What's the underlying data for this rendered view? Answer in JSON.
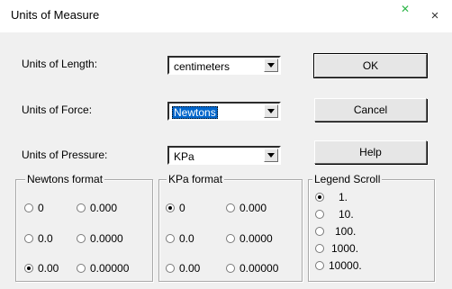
{
  "window": {
    "title": "Units of Measure",
    "close_glyph": "×",
    "background_mark": "✕"
  },
  "fields": [
    {
      "label": "Units of Length:",
      "value": "centimeters",
      "selected": false
    },
    {
      "label": "Units of Force:",
      "value": "Newtons",
      "selected": true
    },
    {
      "label": "Units of Pressure:",
      "value": "KPa",
      "selected": false
    }
  ],
  "buttons": {
    "ok": "OK",
    "cancel": "Cancel",
    "help": "Help"
  },
  "newtons_format": {
    "title": "Newtons format",
    "options": [
      "0",
      "0.000",
      "0.0",
      "0.0000",
      "0.00",
      "0.00000"
    ],
    "selected": "0.00"
  },
  "kpa_format": {
    "title": "KPa format",
    "options": [
      "0",
      "0.000",
      "0.0",
      "0.0000",
      "0.00",
      "0.00000"
    ],
    "selected": "0"
  },
  "legend_scroll": {
    "title": "Legend Scroll",
    "options": [
      "1.",
      "10.",
      "100.",
      "1000.",
      "10000."
    ],
    "selected": "1."
  }
}
